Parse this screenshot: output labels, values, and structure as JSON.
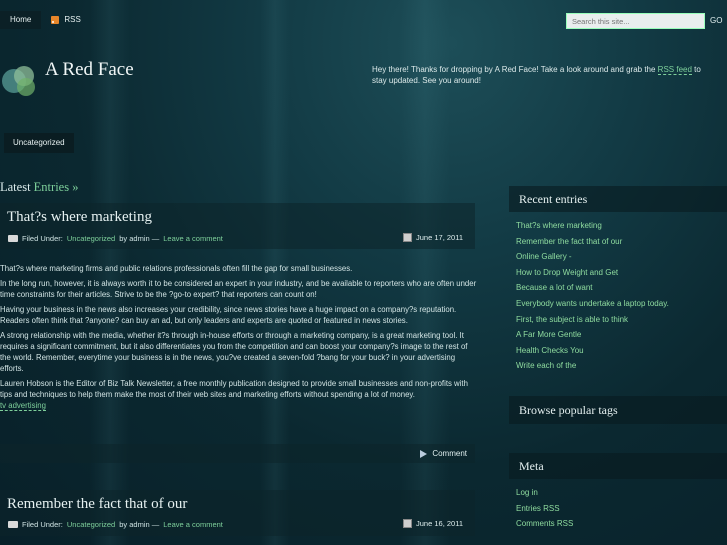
{
  "nav": {
    "home": "Home",
    "rss": "RSS"
  },
  "search": {
    "placeholder": "Search this site...",
    "go": "GO"
  },
  "site": {
    "title": "A Red Face"
  },
  "intro": {
    "before": "Hey there! Thanks for dropping by A Red Face! Take a look around and grab the ",
    "link": "RSS feed",
    "after": " to stay updated. See you around!"
  },
  "categories": [
    "Uncategorized"
  ],
  "latest": {
    "prefix": "Latest ",
    "highlight": "Entries »"
  },
  "posts": [
    {
      "title": "That?s where marketing",
      "filed_label": "Filed Under:",
      "category": "Uncategorized",
      "by": "by admin —",
      "comment_link": "Leave a comment",
      "date": "June 17, 2011",
      "paragraphs": [
        "That?s where marketing firms and public relations professionals often fill the gap for small businesses.",
        "In the long run, however, it is always worth it to be considered an expert in your industry, and be available to reporters who are often under time constraints for their articles. Strive to be the ?go-to expert? that reporters can count on!",
        "Having your business in the news also increases your credibility, since news stories have a huge impact on a company?s reputation. Readers often think that ?anyone? can buy an ad, but only leaders and experts are quoted or featured in news stories.",
        "A strong relationship with the media, whether it?s through in-house efforts or through a marketing company, is a great marketing tool. It requires a significant commitment, but it also differentiates you from the competition and can boost your company?s image to the rest of the world. Remember, everytime your business is in the news, you?ve created a seven-fold ?bang for your buck? in your advertising efforts.",
        "Lauren Hobson is the Editor of Biz Talk Newsletter, a free monthly publication designed to provide small businesses and non-profits with tips and techniques to help them make the most of their web sites and marketing efforts without spending a lot of money."
      ],
      "tag": "tv advertising",
      "comment_button": "Comment"
    },
    {
      "title": "Remember the fact that of our",
      "filed_label": "Filed Under:",
      "category": "Uncategorized",
      "by": "by admin —",
      "comment_link": "Leave a comment",
      "date": "June 16, 2011"
    }
  ],
  "sidebar": {
    "recent_title": "Recent entries",
    "recent": [
      "That?s where marketing",
      "Remember the fact that of our",
      "Online Gallery -",
      "How to Drop Weight and Get",
      "Because a lot of want",
      "Everybody wants undertake a laptop today.",
      "First, the subject is able to think",
      "A Far More Gentle",
      "Health Checks You",
      "Write each of the"
    ],
    "tags_title": "Browse popular tags",
    "meta_title": "Meta",
    "meta": [
      "Log in",
      "Entries RSS",
      "Comments RSS"
    ]
  },
  "colors": {
    "accent": "#7ed09b",
    "background": "#0b2830"
  }
}
